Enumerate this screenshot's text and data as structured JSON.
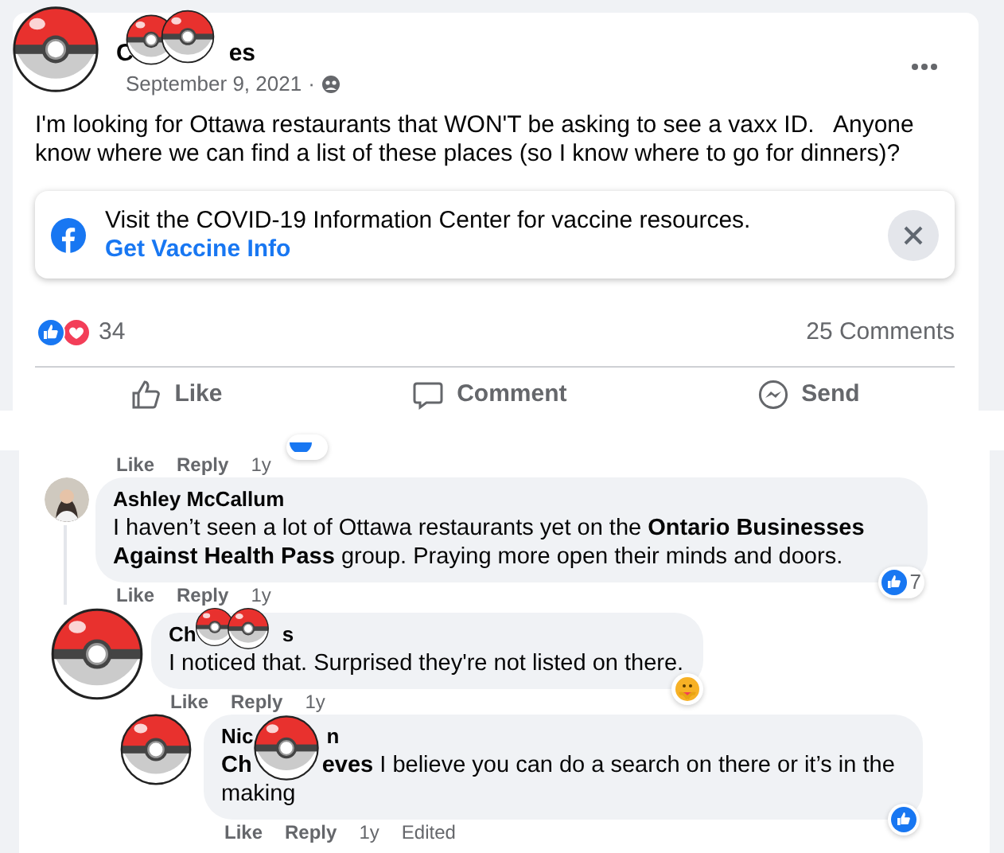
{
  "post": {
    "author_visible": [
      "C",
      "es"
    ],
    "date": "September 9, 2021",
    "date_separator": "·",
    "text": "I'm looking for Ottawa restaurants that WON'T be asking to see a vaxx ID.   Anyone know where we can find a list of these places (so I know where to go for dinners)?",
    "info_box": {
      "text": "Visit the COVID-19 Information Center for vaccine resources.",
      "link": "Get Vaccine Info"
    },
    "reaction_count": "34",
    "comments_count": "25 Comments",
    "actions": [
      {
        "kind": "like",
        "label": "Like"
      },
      {
        "kind": "comment",
        "label": "Comment"
      },
      {
        "kind": "send",
        "label": "Send"
      }
    ]
  },
  "comments": [
    {
      "kind": "cut",
      "actions": [
        "Like",
        "Reply",
        "1y"
      ]
    },
    {
      "kind": "comment",
      "name_parts": [
        "Ashley McCallum"
      ],
      "text_parts": [
        "I haven’t seen a lot of Ottawa restaurants yet on the **Ontario Businesses Against Health Pass** group. Praying more open their minds and doors."
      ],
      "actions": [
        "Like",
        "Reply",
        "1y"
      ],
      "reaction": {
        "kind": "like",
        "count": "7"
      },
      "children": [
        {
          "kind": "comment",
          "name_parts": [
            "Ch",
            "s"
          ],
          "text_parts": [
            "I noticed that. Surprised they're not listed on there."
          ],
          "actions": [
            "Like",
            "Reply",
            "1y"
          ],
          "reaction": {
            "kind": "care"
          },
          "children": [
            {
              "kind": "comment",
              "name_parts": [
                "Nic",
                "n"
              ],
              "text_parts": [
                "**Ch**",
                "**eves** I believe you can do a search on there or it’s in the making"
              ],
              "actions": [
                "Like",
                "Reply",
                "1y",
                "Edited"
              ],
              "reaction": {
                "kind": "like"
              }
            }
          ]
        }
      ]
    }
  ]
}
